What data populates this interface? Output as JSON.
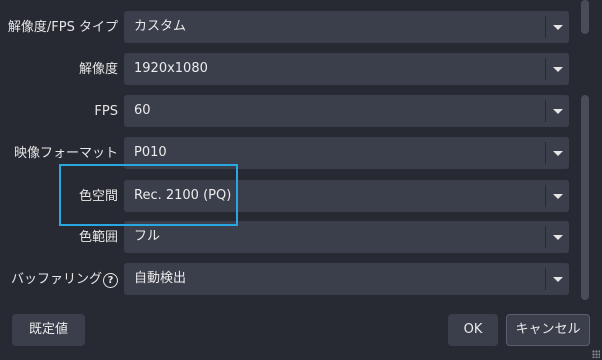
{
  "rows": [
    {
      "label": "解像度/FPS タイプ",
      "value": "カスタム"
    },
    {
      "label": "解像度",
      "value": "1920x1080"
    },
    {
      "label": "FPS",
      "value": "60"
    },
    {
      "label": "映像フォーマット",
      "value": "P010"
    },
    {
      "label": "色空間",
      "value": "Rec. 2100 (PQ)"
    },
    {
      "label": "色範囲",
      "value": "フル"
    },
    {
      "label": "バッファリング",
      "value": "自動検出",
      "help_icon": "?"
    }
  ],
  "buttons": {
    "defaults": "既定値",
    "ok": "OK",
    "cancel": "キャンセル"
  },
  "colors": {
    "background": "#272a33",
    "combo": "#3b3e4b",
    "highlight": "#2aa6e0"
  },
  "icons": [
    "chevron-down-icon",
    "help-circle-icon",
    "resize-grip-icon"
  ]
}
